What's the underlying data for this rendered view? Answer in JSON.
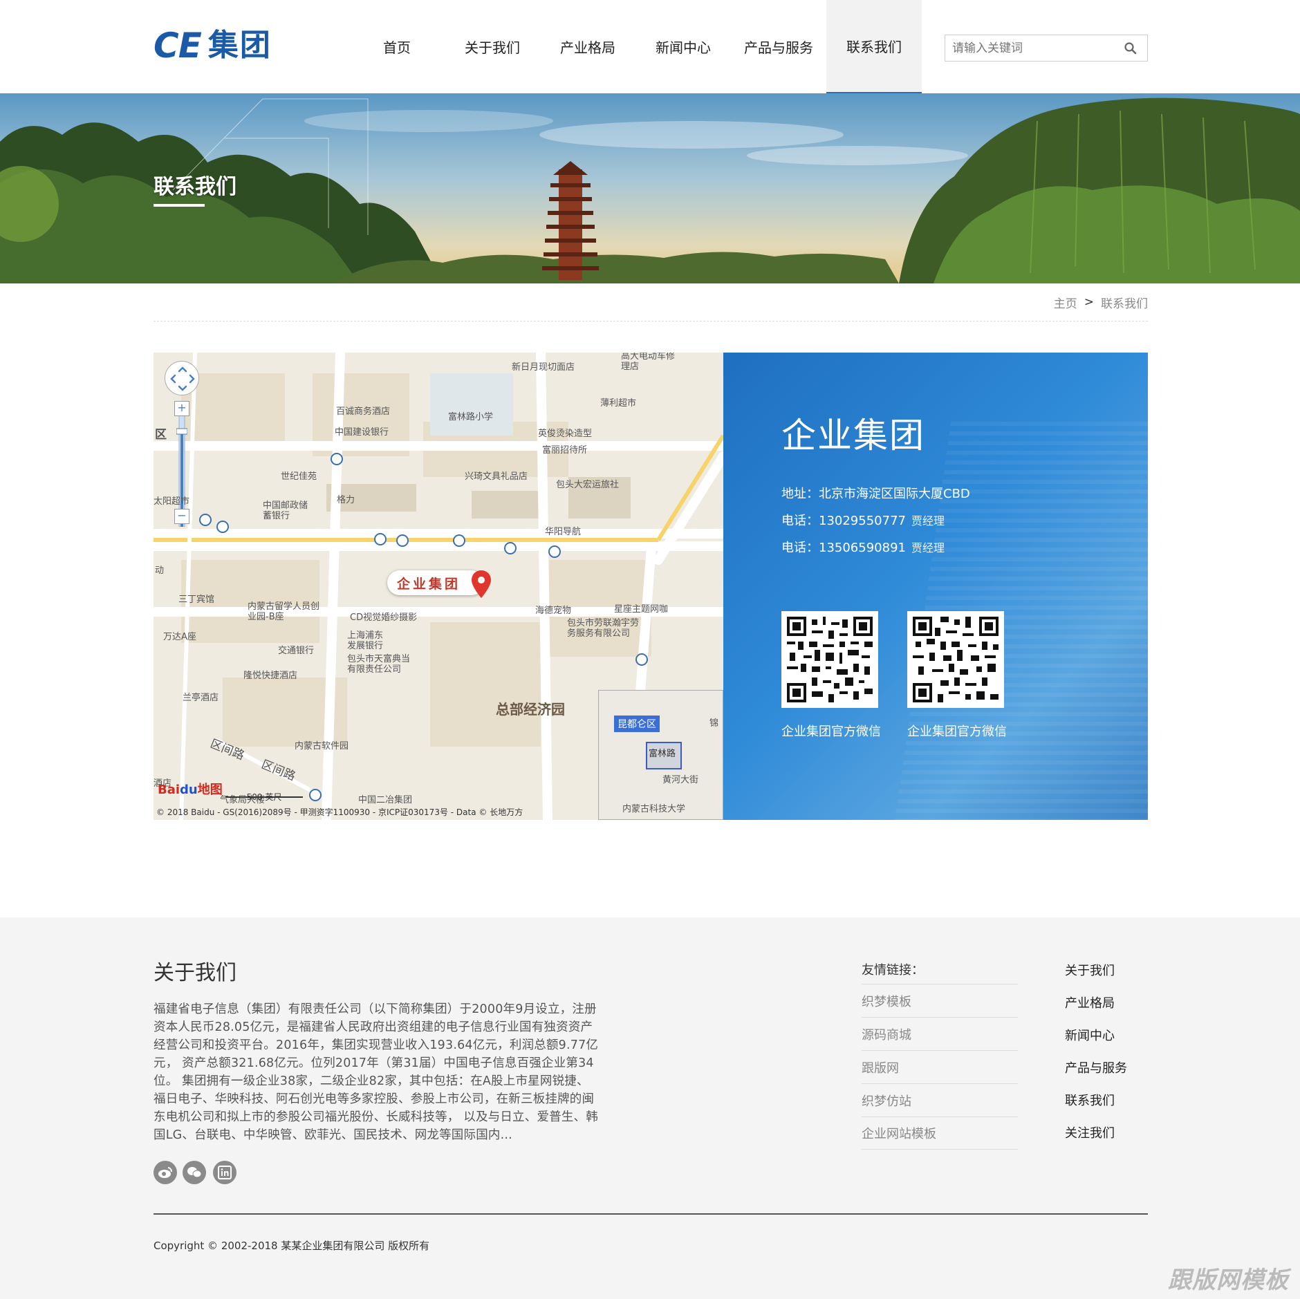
{
  "header": {
    "logo_ce": "CE",
    "logo_group": "集团",
    "nav": [
      {
        "label": "首页"
      },
      {
        "label": "关于我们"
      },
      {
        "label": "产业格局"
      },
      {
        "label": "新闻中心"
      },
      {
        "label": "产品与服务"
      },
      {
        "label": "联系我们",
        "active": true
      }
    ],
    "search_placeholder": "请输入关键词"
  },
  "banner": {
    "title": "联系我们"
  },
  "breadcrumb": {
    "home": "主页",
    "separator": ">",
    "current": "联系我们"
  },
  "map": {
    "marker_label": "企业集团",
    "district_label": "总部经济园",
    "labels": [
      "新日月现切面店",
      "高大电动车修理店",
      "薄利超市",
      "百诚商务酒店",
      "富林路小学",
      "中国建设银行",
      "英俊烫染造型",
      "富丽招待所",
      "世纪佳苑",
      "兴琦文具礼品店",
      "包头大宏运旅社",
      "格力",
      "中国邮政储蓄银行",
      "华阳导航",
      "三丁宾馆",
      "内蒙古留学人员创业园-B座",
      "CD视觉婚纱摄影",
      "海德宠物",
      "星座主题网咖",
      "万达A座",
      "交通银行",
      "上海浦东发展银行",
      "包头市劳联瀚宇劳务服务有限公司",
      "隆悦快捷酒店",
      "包头市天富典当有限责任公司",
      "兰亭酒店",
      "内蒙古软件园",
      "中国二冶集团",
      "区间路",
      "区间路",
      "太阳超市",
      "区",
      "动",
      "酒店",
      "气象局大楼"
    ],
    "scale_label": "500 英尺",
    "copyright": "© 2018 Baidu - GS(2016)2089号 - 甲测资字1100930 - 京ICP证030173号 - Data © 长地万方",
    "overview": {
      "district": "昆都仑区",
      "road1": "富林路",
      "road2": "黄河大街",
      "uni": "内蒙古科技大学",
      "extra": "锦"
    },
    "baidu_logo_a": "Bai",
    "baidu_logo_b": "du",
    "baidu_logo_c": "地图"
  },
  "contact": {
    "company": "企业集团",
    "address_label": "地址：",
    "address": "北京市海淀区国际大厦CBD",
    "phone_label": "电话：",
    "phone1": "13029550777",
    "phone1_tail": "贾经理",
    "phone2": "13506590891",
    "phone2_tail": "贾经理",
    "qr1_label": "企业集团官方微信",
    "qr2_label": "企业集团官方微信"
  },
  "footer": {
    "about_title": "关于我们",
    "about_text": "福建省电子信息（集团）有限责任公司（以下简称集团）于2000年9月设立，注册资本人民币28.05亿元，是福建省人民政府出资组建的电子信息行业国有独资资产经营公司和投资平台。2016年，集团实现营业收入193.64亿元，利润总额9.77亿元， 资产总额321.68亿元。位列2017年（第31届）中国电子信息百强企业第34位。 集团拥有一级企业38家，二级企业82家，其中包括：在A股上市星网锐捷、福日电子、华映科技、阿石创光电等多家控股、参股上市公司，在新三板挂牌的闽东电机公司和拟上市的参股公司福光股份、长威科技等， 以及与日立、爱普生、韩国LG、台联电、中华映管、欧菲光、国民技术、网龙等国际国内...",
    "links_title": "友情链接：",
    "links": [
      "织梦模板",
      "源码商城",
      "跟版网",
      "织梦仿站",
      "企业网站模板"
    ],
    "nav_links": [
      "关于我们",
      "产业格局",
      "新闻中心",
      "产品与服务",
      "联系我们",
      "关注我们"
    ],
    "copyright": "Copyright © 2002-2018 某某企业集团有限公司 版权所有",
    "watermark": "跟版网模板"
  },
  "colors": {
    "brand": "#1b5aa6",
    "panel_blue": "#2f8ad8",
    "footer_bg": "#f4f4f4"
  },
  "icons": [
    "search-icon",
    "weibo-icon",
    "wechat-icon",
    "linkedin-icon",
    "map-pin-icon",
    "bus-stop-icon"
  ]
}
